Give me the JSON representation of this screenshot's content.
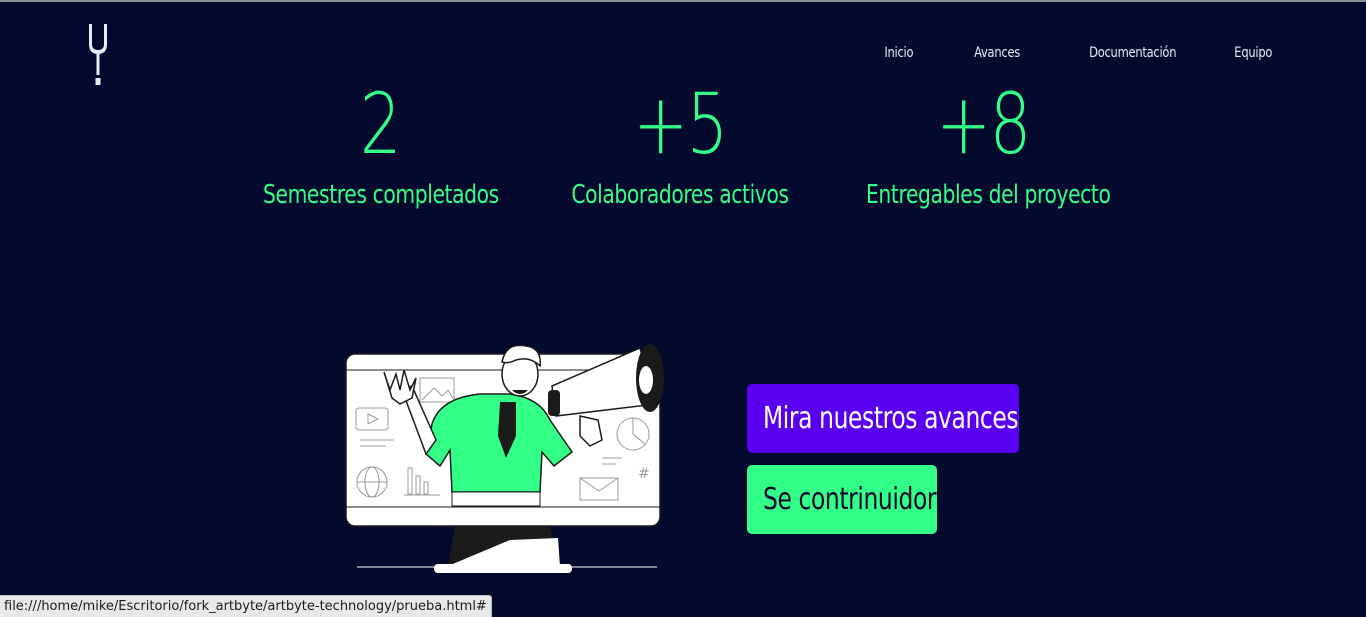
{
  "nav": {
    "items": [
      {
        "label": "Inicio"
      },
      {
        "label": "Avances"
      },
      {
        "label": "Documentación"
      },
      {
        "label": "Equipo"
      }
    ]
  },
  "stats": [
    {
      "value": "2",
      "label": "Semestres completados"
    },
    {
      "value": "+5",
      "label": "Colaboradores activos"
    },
    {
      "value": "+8",
      "label": "Entregables del proyecto"
    }
  ],
  "buttons": {
    "avances_label": "Mira nuestros avances",
    "contribute_label": "Se contrinuidor"
  },
  "status_bar": {
    "url": "file:///home/mike/Escritorio/fork_artbyte/artbyte-technology/prueba.html#"
  },
  "colors": {
    "background": "#030A2E",
    "accent_green": "#33FF88",
    "accent_purple": "#5A00F0",
    "nav_text": "#E9ECF5"
  },
  "icons": {
    "logo": "tuning-fork-logo",
    "illustration": "man-with-megaphone-in-monitor"
  }
}
